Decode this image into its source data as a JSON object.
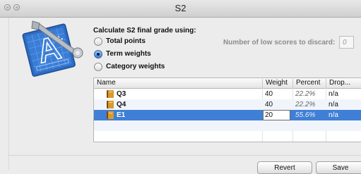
{
  "window": {
    "title": "S2"
  },
  "options": {
    "heading": "Calculate S2 final grade using:",
    "choices": [
      {
        "label": "Total points",
        "selected": false
      },
      {
        "label": "Term weights",
        "selected": true
      },
      {
        "label": "Category weights",
        "selected": false
      }
    ],
    "discard_label": "Number of low scores to discard:",
    "discard_value": "0"
  },
  "table": {
    "columns": [
      "Name",
      "Weight",
      "Percent",
      "Drop..."
    ],
    "rows": [
      {
        "name": "Q3",
        "weight": "40",
        "percent": "22.2%",
        "drop": "n/a"
      },
      {
        "name": "Q4",
        "weight": "40",
        "percent": "22.2%",
        "drop": "n/a"
      },
      {
        "name": "E1",
        "weight": "20",
        "percent": "55.6%",
        "drop": "n/a"
      }
    ]
  },
  "buttons": {
    "revert": "Revert",
    "save": "Save"
  },
  "colors": {
    "selection": "#3f7fd6",
    "icon_blue": "#2f6cc2"
  },
  "icons": [
    "close-button-icon",
    "minimize-button-icon",
    "grade-blueprint-app-icon",
    "wrench-icon",
    "book-icon"
  ]
}
